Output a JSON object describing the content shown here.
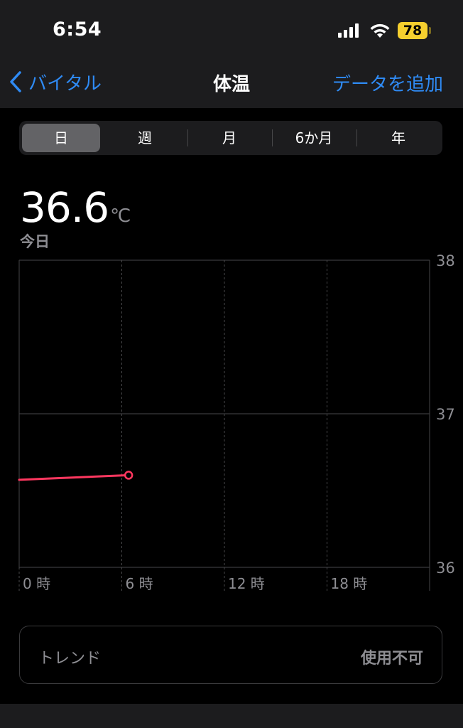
{
  "status_bar": {
    "time": "6:54",
    "battery": "78",
    "signal_icon": "cellular-signal-icon",
    "wifi_icon": "wifi-icon"
  },
  "nav": {
    "back_label": "バイタル",
    "title": "体温",
    "action_label": "データを追加",
    "accent_color": "#2f8bf5"
  },
  "segments": {
    "items": [
      "日",
      "週",
      "月",
      "6か月",
      "年"
    ],
    "selected": "日"
  },
  "summary": {
    "value": "36.6",
    "unit": "℃",
    "period": "今日"
  },
  "chart_data": {
    "type": "line",
    "x_tick_labels": [
      "0 時",
      "6 時",
      "12 時",
      "18 時"
    ],
    "y_tick_labels": [
      "38",
      "37",
      "36"
    ],
    "xlim": [
      0,
      24
    ],
    "ylim": [
      36,
      38
    ],
    "series": [
      {
        "color": "#ff375f",
        "x": [
          0,
          6.4
        ],
        "y": [
          36.57,
          36.6
        ]
      }
    ],
    "grid": true
  },
  "trend": {
    "label": "トレンド",
    "value": "使用不可"
  }
}
